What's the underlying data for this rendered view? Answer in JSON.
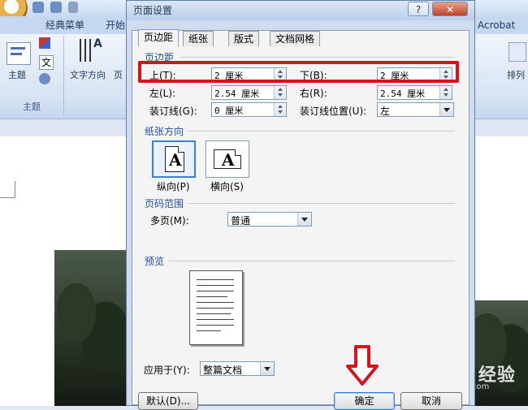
{
  "ribbon": {
    "tabs": [
      "经典菜单",
      "开始"
    ],
    "right_tab": "Acrobat",
    "group_theme_btn": "主题",
    "group_theme_label": "主题",
    "text_direction": "文字方向",
    "page_partial": "页",
    "arrange": "排列",
    "colors_glyph": "文"
  },
  "dialog": {
    "title": "页面设置",
    "help": "?",
    "close": "✕",
    "tabs": [
      "页边距",
      "纸张",
      "版式",
      "文档网格"
    ],
    "margins": {
      "section": "页边距",
      "top_label": "上(T):",
      "top_value": "2 厘米",
      "bottom_label": "下(B):",
      "bottom_value": "2 厘米",
      "left_label": "左(L):",
      "left_value": "2.54 厘米",
      "right_label": "右(R):",
      "right_value": "2.54 厘米",
      "gutter_label": "装订线(G):",
      "gutter_value": "0 厘米",
      "gutter_pos_label": "装订线位置(U):",
      "gutter_pos_value": "左"
    },
    "orientation": {
      "section": "纸张方向",
      "portrait": "纵向(P)",
      "landscape": "横向(S)",
      "glyph": "A"
    },
    "pages": {
      "section": "页码范围",
      "multiple_label": "多页(M):",
      "multiple_value": "普通"
    },
    "preview": {
      "section": "预览"
    },
    "apply": {
      "label": "应用于(Y):",
      "value": "整篇文档"
    },
    "buttons": {
      "default": "默认(D)...",
      "ok": "确定",
      "cancel": "取消"
    }
  },
  "watermark": {
    "brand": "Bai du 经验",
    "url": "jingyan.baidu.com"
  },
  "colors": {
    "highlight": "#d8121b",
    "section_label": "#1f4fa0"
  }
}
